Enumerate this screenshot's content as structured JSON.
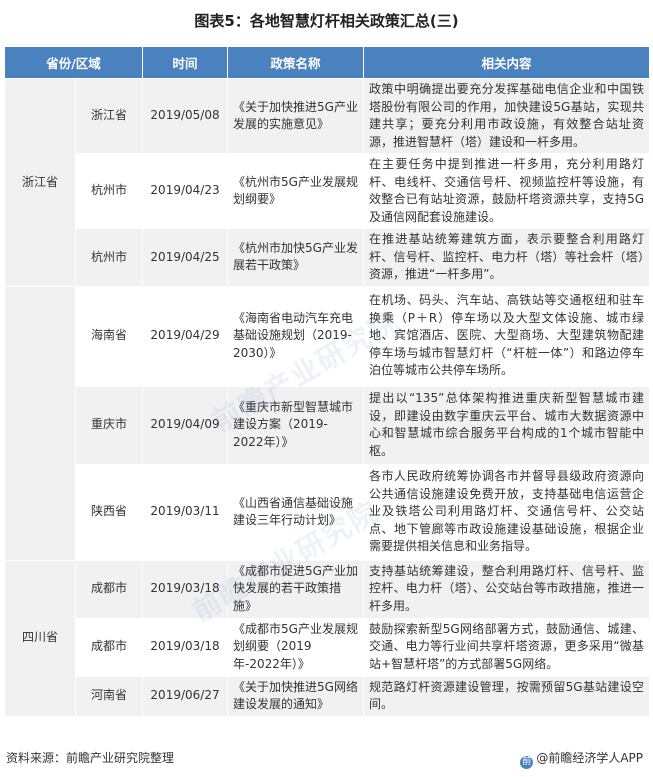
{
  "title": "图表5：各地智慧灯杆相关政策汇总(三)",
  "table": {
    "headers": [
      "省份/区域",
      "时间",
      "政策名称",
      "相关内容"
    ],
    "rows": [
      {
        "province": "浙江省",
        "city": "浙江省",
        "time": "2019/05/08",
        "name": "《关于加快推进5G产业发展的实施意见》",
        "content": "政策中明确提出要充分发挥基础电信企业和中国铁塔股份有限公司的作用，加快建设5G基站，实现共建共享；要充分利用市政设施，有效整合站址资源，推进智慧杆（塔）建设和一杆多用。"
      },
      {
        "province": "",
        "city": "杭州市",
        "time": "2019/04/23",
        "name": "《杭州市5G产业发展规划纲要》",
        "content": "在主要任务中提到推进一杆多用，充分利用路灯杆、电线杆、交通信号杆、视频监控杆等设施，有效整合已有站址资源，鼓励杆塔资源共享，支持5G及通信网配套设施建设。"
      },
      {
        "province": "",
        "city": "杭州市",
        "time": "2019/04/25",
        "name": "《杭州市加快5G产业发展若干政策》",
        "content": "在推进基站统筹建筑方面，表示要整合利用路灯杆、信号杆、监控杆、电力杆（塔）等社会杆（塔）资源，推进“一杆多用”。"
      },
      {
        "province": "",
        "city": "海南省",
        "time": "2019/04/29",
        "name": "《海南省电动汽车充电基础设施规划（2019-2030）》",
        "content": "在机场、码头、汽车站、高铁站等交通枢纽和驻车换乘（P＋R）停车场以及大型文体设施、城市绿地、宾馆酒店、医院、大型商场、大型建筑物配建停车场与城市智慧灯杆（“杆桩一体”）和路边停车泊位等城市公共停车场所。"
      },
      {
        "province": "",
        "city": "重庆市",
        "time": "2019/04/09",
        "name": "《重庆市新型智慧城市建设方案（2019-2022年）》",
        "content": "提出以“135”总体架构推进重庆新型智慧城市建设，即建设由数字重庆云平台、城市大数据资源中心和智慧城市综合服务平台构成的1个城市智能中枢。"
      },
      {
        "province": "",
        "city": "陕西省",
        "time": "2019/03/11",
        "name": "《山西省通信基础设施建设三年行动计划》",
        "content": "各市人民政府统筹协调各市并督导县级政府资源向公共通信设施建设免费开放，支持基础电信运营企业及铁塔公司利用路灯杆、交通信号杆、公交站点、地下管廊等市政设施建设基础设施，根据企业需要提供相关信息和业务指导。"
      },
      {
        "province": "四川省",
        "city": "成都市",
        "time": "2019/03/18",
        "name": "《成都市促进5G产业加快发展的若干政策措施》",
        "content": "支持基站统筹建设，整合利用路灯杆、信号杆、监控杆、电力杆（塔）、公交站台等市政措施，推进一杆多用。"
      },
      {
        "province": "",
        "city": "成都市",
        "time": "2019/03/18",
        "name": "《成都市5G产业发展规划纲要（2019年-2022年）》",
        "content": "鼓励探索新型5G网络部署方式，鼓励通信、城建、交通、电力等行业间共享杆塔资源，更多采用“微基站+智慧杆塔”的方式部署5G网络。"
      },
      {
        "province": "",
        "city": "河南省",
        "time": "2019/06/27",
        "name": "《关于加快推进5G网络建设发展的通知》",
        "content": "规范路灯杆资源建设管理，按需预留5G基站建设空间。"
      }
    ]
  },
  "watermark": "前瞻产业研究院",
  "footer": {
    "source": "资料来源：前瞻产业研究院整理",
    "brand": "@前瞻经济学人APP"
  }
}
